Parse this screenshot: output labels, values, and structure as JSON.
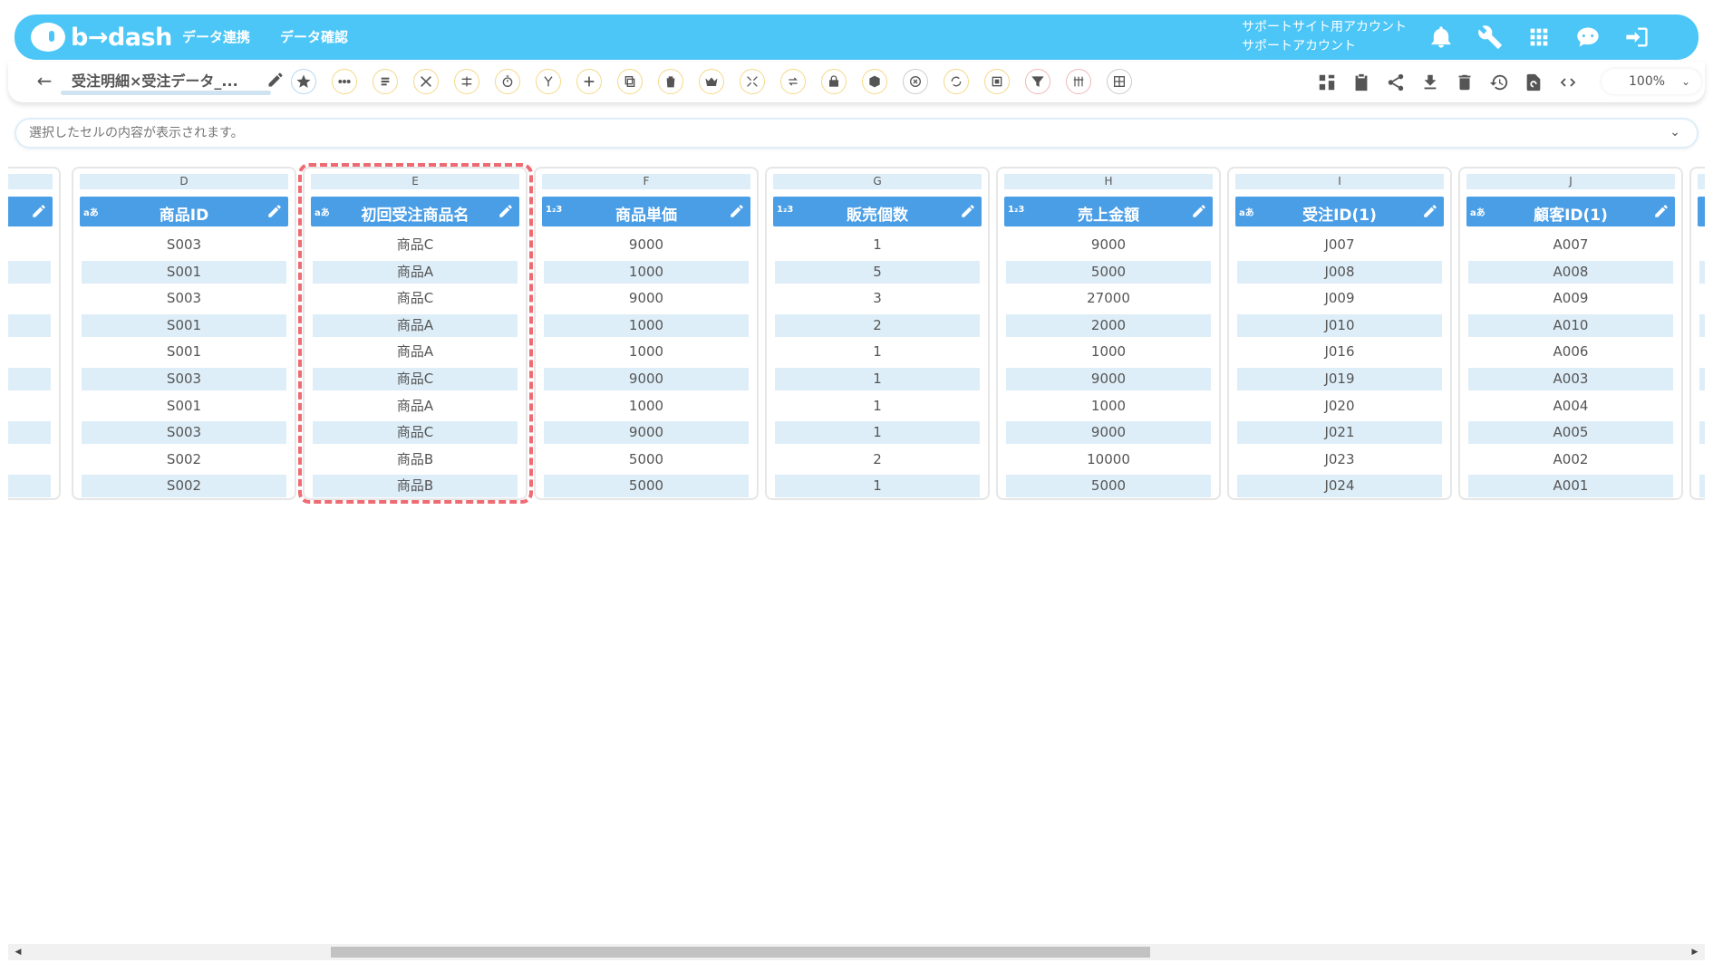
{
  "app": {
    "logo_text": "b→dash",
    "nav": [
      "データ連携",
      "データ確認"
    ],
    "account_line1": "サポートサイト用アカウント",
    "account_line2": "サポートアカウント"
  },
  "toolbar": {
    "title": "受注明細×受注データ_...",
    "zoom": "100%"
  },
  "cellbar": {
    "placeholder": "選択したセルの内容が表示されます。"
  },
  "columns": [
    {
      "letter": "D",
      "type": "aあ",
      "name": "商品ID",
      "values": [
        "S003",
        "S001",
        "S003",
        "S001",
        "S001",
        "S003",
        "S001",
        "S003",
        "S002",
        "S002"
      ]
    },
    {
      "letter": "E",
      "type": "aあ",
      "name": "初回受注商品名",
      "values": [
        "商品C",
        "商品A",
        "商品C",
        "商品A",
        "商品A",
        "商品C",
        "商品A",
        "商品C",
        "商品B",
        "商品B"
      ]
    },
    {
      "letter": "F",
      "type": "1₂3",
      "name": "商品単価",
      "values": [
        "9000",
        "1000",
        "9000",
        "1000",
        "1000",
        "9000",
        "1000",
        "9000",
        "5000",
        "5000"
      ]
    },
    {
      "letter": "G",
      "type": "1₂3",
      "name": "販売個数",
      "values": [
        "1",
        "5",
        "3",
        "2",
        "1",
        "1",
        "1",
        "1",
        "2",
        "1"
      ]
    },
    {
      "letter": "H",
      "type": "1₂3",
      "name": "売上金額",
      "values": [
        "9000",
        "5000",
        "27000",
        "2000",
        "1000",
        "9000",
        "1000",
        "9000",
        "10000",
        "5000"
      ]
    },
    {
      "letter": "I",
      "type": "aあ",
      "name": "受注ID(1)",
      "values": [
        "J007",
        "J008",
        "J009",
        "J010",
        "J016",
        "J019",
        "J020",
        "J021",
        "J023",
        "J024"
      ]
    },
    {
      "letter": "J",
      "type": "aあ",
      "name": "顧客ID(1)",
      "values": [
        "A007",
        "A008",
        "A009",
        "A010",
        "A006",
        "A003",
        "A004",
        "A005",
        "A002",
        "A001"
      ]
    }
  ],
  "colors": {
    "header_bar": "#4cc6f7",
    "column_header": "#4a9ee6",
    "cell_shade": "#deeef8",
    "highlight": "#ef6b73"
  }
}
